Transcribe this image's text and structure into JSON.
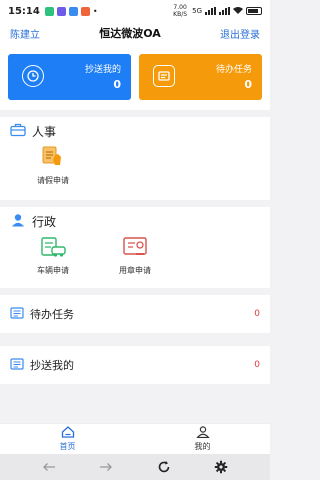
{
  "status_bar": {
    "time": "15:14",
    "speed": "7.00 KB/S",
    "network": "5G",
    "battery": ""
  },
  "header": {
    "user": "陈建立",
    "title": "恒达微波OA",
    "logout": "退出登录"
  },
  "cards": [
    {
      "label": "抄送我的",
      "count": "0",
      "color": "#1e7ef5"
    },
    {
      "label": "待办任务",
      "count": "0",
      "color": "#f59a0a"
    }
  ],
  "sections": [
    {
      "title": "人事",
      "apps": [
        {
          "label": "请假申请",
          "icon": "leave-icon"
        }
      ]
    },
    {
      "title": "行政",
      "apps": [
        {
          "label": "车辆申请",
          "icon": "vehicle-icon"
        },
        {
          "label": "用章申请",
          "icon": "seal-icon"
        }
      ]
    }
  ],
  "rows": [
    {
      "label": "待办任务",
      "count": "0"
    },
    {
      "label": "抄送我的",
      "count": "0"
    }
  ],
  "tabbar": [
    {
      "label": "首页",
      "icon": "home-icon",
      "active": true
    },
    {
      "label": "我的",
      "icon": "user-icon",
      "active": false
    }
  ],
  "navbar": {
    "icons": [
      "back-icon",
      "forward-icon",
      "refresh-icon",
      "settings-icon"
    ]
  }
}
